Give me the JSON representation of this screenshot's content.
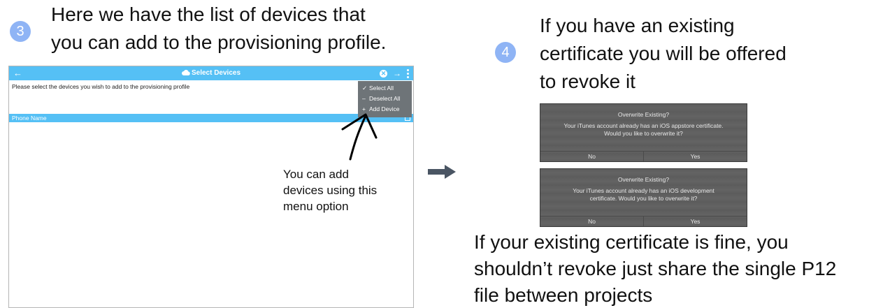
{
  "step3": {
    "number": "3",
    "heading_line1": "Here we have the list of devices that",
    "heading_line2": "you can add to the provisioning profile."
  },
  "app": {
    "title": "Select Devices",
    "instructions": "Please select the devices you wish to add to the provisioning profile",
    "column_header": "Phone Name",
    "menu": [
      {
        "icon": "check-icon",
        "label": "Select All"
      },
      {
        "icon": "minus-icon",
        "label": "Deselect All"
      },
      {
        "icon": "plus-icon",
        "label": "Add Device"
      }
    ]
  },
  "annotation": {
    "line1": "You can add",
    "line2": "devices using this",
    "line3": "menu option"
  },
  "step4": {
    "number": "4",
    "heading_line1": "If you have an existing",
    "heading_line2": "certificate you will be offered",
    "heading_line3": "to revoke it"
  },
  "dialogs": [
    {
      "title": "Overwrite Existing?",
      "message_line1": "Your iTunes account already has an iOS appstore certificate.",
      "message_line2": "Would you like to overwrite it?",
      "no_label": "No",
      "yes_label": "Yes"
    },
    {
      "title": "Overwrite Existing?",
      "message_line1": "Your iTunes account already has an iOS development",
      "message_line2": "certificate.  Would you like to overwrite it?",
      "no_label": "No",
      "yes_label": "Yes"
    }
  ],
  "footer": {
    "line1": "If your existing certificate is fine, you",
    "line2": "shouldn’t revoke just share the single P12",
    "line3": "file between projects"
  },
  "colors": {
    "badge": "#8fb4f5",
    "app_accent": "#55c0f5",
    "dialog_bg": "#5e5e5e"
  }
}
